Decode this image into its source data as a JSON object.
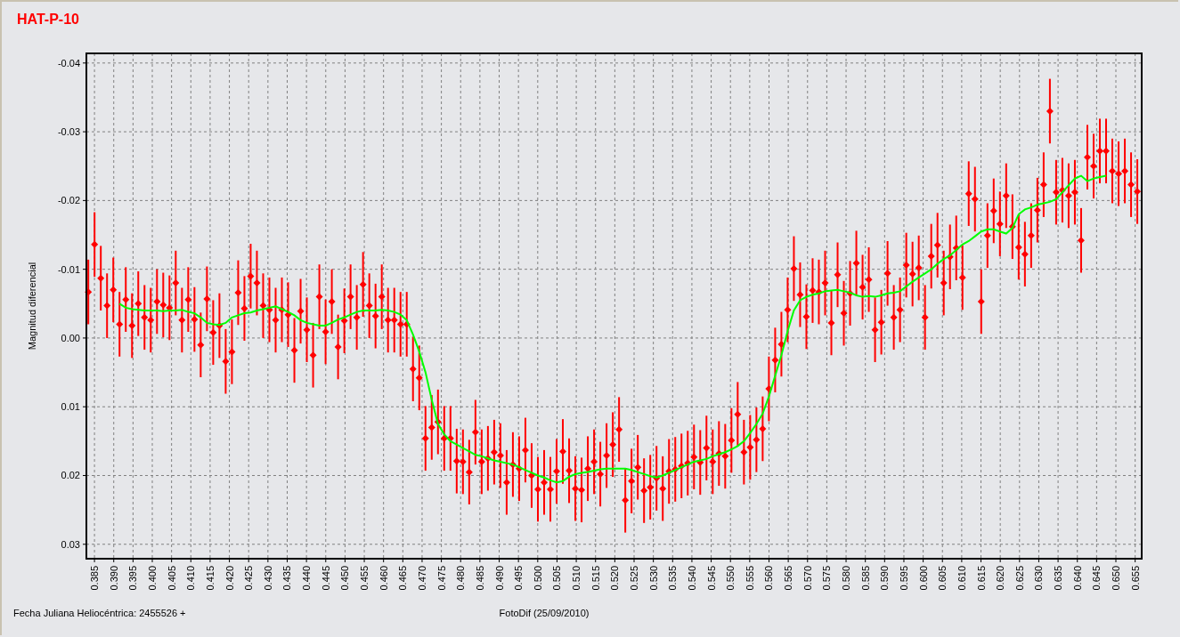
{
  "chart": {
    "chart_data": {
      "type": "scatter",
      "title": "HAT-P-10",
      "ylabel": "Magnitud diferencial",
      "grid": true,
      "xlim": [
        0.3829,
        0.6567
      ],
      "ylim": [
        0.0321,
        -0.0414
      ],
      "yticks": [
        {
          "value": -0.04,
          "label": "-0.04"
        },
        {
          "value": -0.03,
          "label": "-0.03"
        },
        {
          "value": -0.02,
          "label": "-0.02"
        },
        {
          "value": -0.01,
          "label": "-0.01"
        },
        {
          "value": 0,
          "label": "0.00"
        },
        {
          "value": 0.01,
          "label": "0.01"
        },
        {
          "value": 0.02,
          "label": "0.02"
        },
        {
          "value": 0.03,
          "label": "0.03"
        }
      ],
      "xticks": [
        {
          "value": 0.385,
          "label": "0.385"
        },
        {
          "value": 0.39,
          "label": "0.390"
        },
        {
          "value": 0.395,
          "label": "0.395"
        },
        {
          "value": 0.4,
          "label": "0.400"
        },
        {
          "value": 0.405,
          "label": "0.405"
        },
        {
          "value": 0.41,
          "label": "0.410"
        },
        {
          "value": 0.415,
          "label": "0.415"
        },
        {
          "value": 0.42,
          "label": "0.420"
        },
        {
          "value": 0.425,
          "label": "0.425"
        },
        {
          "value": 0.43,
          "label": "0.430"
        },
        {
          "value": 0.435,
          "label": "0.435"
        },
        {
          "value": 0.44,
          "label": "0.440"
        },
        {
          "value": 0.445,
          "label": "0.445"
        },
        {
          "value": 0.45,
          "label": "0.450"
        },
        {
          "value": 0.455,
          "label": "0.455"
        },
        {
          "value": 0.46,
          "label": "0.460"
        },
        {
          "value": 0.465,
          "label": "0.465"
        },
        {
          "value": 0.47,
          "label": "0.470"
        },
        {
          "value": 0.475,
          "label": "0.475"
        },
        {
          "value": 0.48,
          "label": "0.480"
        },
        {
          "value": 0.485,
          "label": "0.485"
        },
        {
          "value": 0.49,
          "label": "0.490"
        },
        {
          "value": 0.495,
          "label": "0.495"
        },
        {
          "value": 0.5,
          "label": "0.500"
        },
        {
          "value": 0.505,
          "label": "0.505"
        },
        {
          "value": 0.51,
          "label": "0.510"
        },
        {
          "value": 0.515,
          "label": "0.515"
        },
        {
          "value": 0.52,
          "label": "0.520"
        },
        {
          "value": 0.525,
          "label": "0.525"
        },
        {
          "value": 0.53,
          "label": "0.530"
        },
        {
          "value": 0.535,
          "label": "0.535"
        },
        {
          "value": 0.54,
          "label": "0.540"
        },
        {
          "value": 0.545,
          "label": "0.545"
        },
        {
          "value": 0.55,
          "label": "0.550"
        },
        {
          "value": 0.555,
          "label": "0.555"
        },
        {
          "value": 0.56,
          "label": "0.560"
        },
        {
          "value": 0.565,
          "label": "0.565"
        },
        {
          "value": 0.57,
          "label": "0.570"
        },
        {
          "value": 0.575,
          "label": "0.575"
        },
        {
          "value": 0.58,
          "label": "0.580"
        },
        {
          "value": 0.585,
          "label": "0.585"
        },
        {
          "value": 0.59,
          "label": "0.590"
        },
        {
          "value": 0.595,
          "label": "0.595"
        },
        {
          "value": 0.6,
          "label": "0.600"
        },
        {
          "value": 0.605,
          "label": "0.605"
        },
        {
          "value": 0.61,
          "label": "0.610"
        },
        {
          "value": 0.615,
          "label": "0.615"
        },
        {
          "value": 0.62,
          "label": "0.620"
        },
        {
          "value": 0.625,
          "label": "0.625"
        },
        {
          "value": 0.63,
          "label": "0.630"
        },
        {
          "value": 0.635,
          "label": "0.635"
        },
        {
          "value": 0.64,
          "label": "0.640"
        },
        {
          "value": 0.645,
          "label": "0.645"
        },
        {
          "value": 0.65,
          "label": "0.650"
        },
        {
          "value": 0.655,
          "label": "0.655"
        }
      ],
      "x": [
        0.3834,
        0.38502,
        0.38664,
        0.38826,
        0.38988,
        0.3915,
        0.39312,
        0.39474,
        0.39636,
        0.39798,
        0.3996,
        0.40122,
        0.40284,
        0.40446,
        0.40608,
        0.4077,
        0.40932,
        0.41094,
        0.41256,
        0.41418,
        0.4158,
        0.41742,
        0.41904,
        0.42066,
        0.42228,
        0.4239,
        0.42552,
        0.42714,
        0.42876,
        0.43038,
        0.432,
        0.43362,
        0.43524,
        0.43686,
        0.43848,
        0.4401,
        0.44172,
        0.44334,
        0.44496,
        0.44658,
        0.4482,
        0.44982,
        0.45144,
        0.45306,
        0.45468,
        0.4563,
        0.45792,
        0.45954,
        0.46116,
        0.46278,
        0.4644,
        0.46602,
        0.46764,
        0.46926,
        0.47088,
        0.4725,
        0.47412,
        0.47574,
        0.47736,
        0.47898,
        0.4806,
        0.48222,
        0.48384,
        0.48546,
        0.48708,
        0.4887,
        0.49032,
        0.49194,
        0.49356,
        0.49518,
        0.4968,
        0.49842,
        0.50004,
        0.50166,
        0.50328,
        0.5049,
        0.50652,
        0.50814,
        0.50976,
        0.51138,
        0.513,
        0.51462,
        0.51624,
        0.51786,
        0.51948,
        0.5211,
        0.52272,
        0.52434,
        0.52596,
        0.52758,
        0.5292,
        0.53082,
        0.53244,
        0.53406,
        0.53568,
        0.5373,
        0.53892,
        0.54054,
        0.54216,
        0.54378,
        0.5454,
        0.54702,
        0.54864,
        0.55026,
        0.55188,
        0.5535,
        0.55512,
        0.55674,
        0.55836,
        0.55998,
        0.5616,
        0.56322,
        0.56484,
        0.56646,
        0.56808,
        0.5697,
        0.57132,
        0.57294,
        0.57456,
        0.57618,
        0.5778,
        0.57942,
        0.58104,
        0.58266,
        0.58428,
        0.5859,
        0.58752,
        0.58914,
        0.59076,
        0.59238,
        0.594,
        0.59562,
        0.59724,
        0.59886,
        0.60048,
        0.6021,
        0.60372,
        0.60534,
        0.60696,
        0.60858,
        0.6102,
        0.61182,
        0.61344,
        0.61506,
        0.61668,
        0.6183,
        0.61992,
        0.62154,
        0.62316,
        0.62478,
        0.6264,
        0.62802,
        0.62964,
        0.63126,
        0.63288,
        0.6345,
        0.63612,
        0.63774,
        0.63936,
        0.64098,
        0.6426,
        0.64422,
        0.64584,
        0.64746,
        0.64908,
        0.6507,
        0.65232,
        0.65394,
        0.65556
      ],
      "series": [
        {
          "type": "scatter",
          "color": "#ff0000",
          "errors": [
            0.0047,
            0.0047,
            0.0047,
            0.0047,
            0.0047,
            0.0047,
            0.0047,
            0.0047,
            0.0047,
            0.0047,
            0.0047,
            0.0047,
            0.0047,
            0.0047,
            0.0047,
            0.0047,
            0.0047,
            0.0047,
            0.0047,
            0.0047,
            0.0047,
            0.0047,
            0.0047,
            0.0047,
            0.0047,
            0.0047,
            0.0047,
            0.0047,
            0.0047,
            0.0047,
            0.0047,
            0.0047,
            0.0047,
            0.0047,
            0.0047,
            0.0047,
            0.0047,
            0.0047,
            0.0047,
            0.0047,
            0.0047,
            0.0047,
            0.0047,
            0.0047,
            0.0047,
            0.0047,
            0.0047,
            0.0047,
            0.0047,
            0.0047,
            0.0047,
            0.0047,
            0.0047,
            0.0047,
            0.0047,
            0.0047,
            0.0047,
            0.0047,
            0.0047,
            0.0047,
            0.0047,
            0.0047,
            0.0047,
            0.0047,
            0.0047,
            0.0047,
            0.0047,
            0.0047,
            0.0047,
            0.0047,
            0.0047,
            0.0047,
            0.0047,
            0.0047,
            0.0047,
            0.0047,
            0.0047,
            0.0047,
            0.0047,
            0.0047,
            0.0047,
            0.0047,
            0.0047,
            0.0047,
            0.0047,
            0.0047,
            0.0047,
            0.0047,
            0.0047,
            0.0047,
            0.0047,
            0.0047,
            0.0047,
            0.0047,
            0.0047,
            0.0047,
            0.0047,
            0.0047,
            0.0047,
            0.0047,
            0.0047,
            0.0047,
            0.0047,
            0.0047,
            0.0047,
            0.0047,
            0.0047,
            0.0047,
            0.0047,
            0.0047,
            0.0047,
            0.0047,
            0.0047,
            0.0047,
            0.0047,
            0.0047,
            0.0047,
            0.0047,
            0.0047,
            0.0047,
            0.0047,
            0.0047,
            0.0047,
            0.0047,
            0.0047,
            0.0047,
            0.0047,
            0.0047,
            0.0047,
            0.0047,
            0.0047,
            0.0047,
            0.0047,
            0.0047,
            0.0047,
            0.0047,
            0.0047,
            0.0047,
            0.0047,
            0.0047,
            0.0047,
            0.0047,
            0.0047,
            0.0047,
            0.0047,
            0.0047,
            0.0047,
            0.0047,
            0.0047,
            0.0047,
            0.0047,
            0.0047,
            0.0047,
            0.0047,
            0.0047,
            0.0047,
            0.0047,
            0.0047,
            0.0047,
            0.0047,
            0.0047,
            0.0047,
            0.0047,
            0.0047,
            0.0047,
            0.0047,
            0.0047,
            0.0047,
            0.0047
          ],
          "values": [
            -0.0067,
            -0.0136,
            -0.0087,
            -0.0047,
            -0.007,
            -0.002,
            -0.0056,
            -0.0018,
            -0.005,
            -0.003,
            -0.0026,
            -0.0053,
            -0.0048,
            -0.0044,
            -0.008,
            -0.0026,
            -0.0056,
            -0.0027,
            0.001,
            -0.0057,
            -0.0008,
            -0.0018,
            0.0034,
            0.002,
            -0.0066,
            -0.0043,
            -0.009,
            -0.008,
            -0.0047,
            -0.0041,
            -0.0026,
            -0.0041,
            -0.0034,
            0.0018,
            -0.0039,
            -0.0012,
            0.0025,
            -0.006,
            -0.0009,
            -0.0053,
            0.0013,
            -0.0025,
            -0.006,
            -0.003,
            -0.0078,
            -0.0047,
            -0.0032,
            -0.006,
            -0.0026,
            -0.0026,
            -0.002,
            -0.002,
            0.0045,
            0.0058,
            0.0146,
            0.013,
            0.0122,
            0.0146,
            0.0146,
            0.0179,
            0.018,
            0.0195,
            0.0137,
            0.018,
            0.0175,
            0.0166,
            0.0171,
            0.021,
            0.0184,
            0.019,
            0.0163,
            0.02,
            0.022,
            0.021,
            0.022,
            0.0194,
            0.0165,
            0.0193,
            0.0219,
            0.0221,
            0.019,
            0.018,
            0.0198,
            0.0171,
            0.0155,
            0.0133,
            0.0236,
            0.0208,
            0.0188,
            0.0222,
            0.0217,
            0.0204,
            0.0219,
            0.0194,
            0.0191,
            0.0186,
            0.0182,
            0.0173,
            0.0181,
            0.016,
            0.018,
            0.0168,
            0.0172,
            0.0149,
            0.0111,
            0.0166,
            0.0159,
            0.0148,
            0.0132,
            0.0074,
            0.0032,
            0.0009,
            -0.0041,
            -0.0101,
            -0.0063,
            -0.0031,
            -0.0069,
            -0.0067,
            -0.008,
            -0.0022,
            -0.0092,
            -0.0036,
            -0.0065,
            -0.0109,
            -0.0074,
            -0.0085,
            -0.0012,
            -0.0023,
            -0.0094,
            -0.003,
            -0.0041,
            -0.0106,
            -0.0093,
            -0.0102,
            -0.003,
            -0.0119,
            -0.0135,
            -0.008,
            -0.0118,
            -0.0131,
            -0.0088,
            -0.021,
            -0.0202,
            -0.0053,
            -0.0149,
            -0.0185,
            -0.0166,
            -0.0207,
            -0.0162,
            -0.0132,
            -0.0122,
            -0.0149,
            -0.0186,
            -0.0223,
            -0.033,
            -0.0212,
            -0.0215,
            -0.0207,
            -0.0212,
            -0.0142,
            -0.0263,
            -0.025,
            -0.0272,
            -0.0272,
            -0.0243,
            -0.0239,
            -0.0243,
            -0.0223,
            -0.0213
          ]
        },
        {
          "type": "line",
          "color": "#00ff00",
          "values": [
            null,
            null,
            null,
            null,
            null,
            -0.005,
            -0.0044,
            -0.0042,
            -0.0041,
            -0.004,
            -0.004,
            -0.004,
            -0.0039,
            -0.004,
            -0.004,
            -0.0041,
            -0.0038,
            -0.0036,
            -0.003,
            -0.0022,
            -0.002,
            -0.0019,
            -0.0022,
            -0.003,
            -0.0033,
            -0.0036,
            -0.0037,
            -0.004,
            -0.0042,
            -0.0044,
            -0.0046,
            -0.0042,
            -0.0038,
            -0.0033,
            -0.0026,
            -0.0022,
            -0.002,
            -0.0018,
            -0.0018,
            -0.0022,
            -0.0027,
            -0.003,
            -0.0034,
            -0.0038,
            -0.004,
            -0.004,
            -0.004,
            -0.0041,
            -0.004,
            -0.0038,
            -0.0034,
            -0.0026,
            -0.0005,
            0.002,
            0.005,
            0.009,
            0.0125,
            0.014,
            0.015,
            0.0155,
            0.016,
            0.0165,
            0.017,
            0.0172,
            0.0175,
            0.0178,
            0.018,
            0.0182,
            0.0184,
            0.0188,
            0.0192,
            0.0196,
            0.02,
            0.0203,
            0.0207,
            0.021,
            0.0208,
            0.0202,
            0.0198,
            0.0196,
            0.0195,
            0.0193,
            0.0191,
            0.019,
            0.019,
            0.019,
            0.019,
            0.0192,
            0.0195,
            0.0198,
            0.0201,
            0.0203,
            0.02,
            0.0196,
            0.0192,
            0.0188,
            0.0184,
            0.018,
            0.0178,
            0.0176,
            0.0172,
            0.0169,
            0.0166,
            0.0162,
            0.0157,
            0.015,
            0.0138,
            0.0125,
            0.011,
            0.0085,
            0.0055,
            0.0025,
            -0.001,
            -0.004,
            -0.0055,
            -0.006,
            -0.0063,
            -0.0065,
            -0.0068,
            -0.0069,
            -0.007,
            -0.0068,
            -0.0066,
            -0.0062,
            -0.006,
            -0.0061,
            -0.006,
            -0.0062,
            -0.0065,
            -0.0066,
            -0.0068,
            -0.0075,
            -0.0082,
            -0.0088,
            -0.0094,
            -0.01,
            -0.0108,
            -0.0115,
            -0.012,
            -0.0128,
            -0.0136,
            -0.0141,
            -0.0148,
            -0.0155,
            -0.0158,
            -0.0158,
            -0.0155,
            -0.0152,
            -0.016,
            -0.018,
            -0.0187,
            -0.019,
            -0.0194,
            -0.0196,
            -0.0198,
            -0.0202,
            -0.0212,
            -0.0222,
            -0.0232,
            -0.0236,
            -0.0228,
            -0.0232,
            -0.0234,
            -0.0236,
            null,
            null,
            null,
            null,
            null
          ]
        }
      ]
    }
  },
  "footer": {
    "left": "Fecha Juliana Heliocéntrica: 2455526 +",
    "center": "FotoDif (25/09/2010)"
  }
}
